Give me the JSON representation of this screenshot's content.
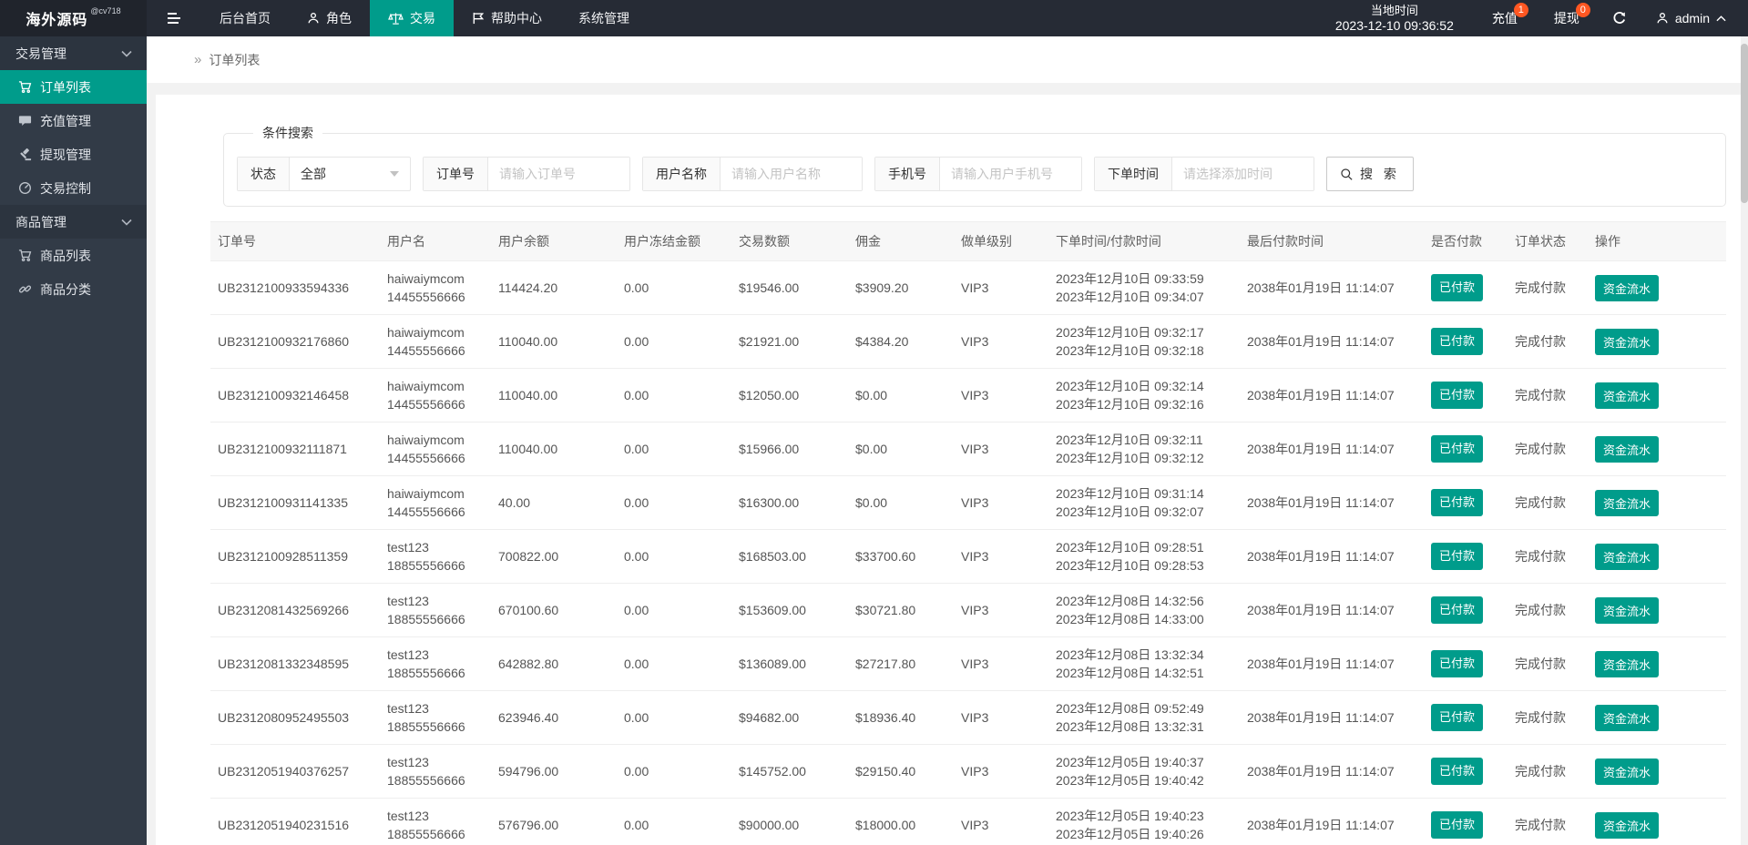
{
  "colors": {
    "accent": "#009C8B",
    "badge": "#FF5722"
  },
  "header": {
    "logo": "海外源码",
    "logo_badge": "@cv718",
    "menu": [
      {
        "label": "后台首页"
      },
      {
        "label": "角色"
      },
      {
        "label": "交易"
      },
      {
        "label": "帮助中心"
      },
      {
        "label": "系统管理"
      }
    ],
    "local_time_label": "当地时间",
    "local_time_value": "2023-12-10 09:36:52",
    "recharge_label": "充值",
    "recharge_badge": "1",
    "withdraw_label": "提现",
    "withdraw_badge": "0",
    "username": "admin"
  },
  "sidebar": {
    "items": [
      {
        "label": "交易管理"
      },
      {
        "label": "订单列表"
      },
      {
        "label": "充值管理"
      },
      {
        "label": "提现管理"
      },
      {
        "label": "交易控制"
      },
      {
        "label": "商品管理"
      },
      {
        "label": "商品列表"
      },
      {
        "label": "商品分类"
      }
    ]
  },
  "breadcrumb": {
    "separator": "»",
    "label": "订单列表"
  },
  "search": {
    "legend": "条件搜索",
    "status_label": "状态",
    "status_value": "全部",
    "order_label": "订单号",
    "order_placeholder": "请输入订单号",
    "username_label": "用户名称",
    "username_placeholder": "请输入用户名称",
    "phone_label": "手机号",
    "phone_placeholder": "请输入用户手机号",
    "time_label": "下单时间",
    "time_placeholder": "请选择添加时间",
    "search_button": "搜 索"
  },
  "table": {
    "headers": [
      "订单号",
      "用户名",
      "用户余额",
      "用户冻结金额",
      "交易数额",
      "佣金",
      "做单级别",
      "下单时间/付款时间",
      "最后付款时间",
      "是否付款",
      "订单状态",
      "操作"
    ],
    "rows": [
      {
        "order_no": "UB2312100933594336",
        "username": "haiwaiymcom",
        "phone": "14455556666",
        "balance": "114424.20",
        "frozen": "0.00",
        "amount": "$19546.00",
        "commission": "$3909.20",
        "level": "VIP3",
        "order_time": "2023年12月10日 09:33:59",
        "pay_time": "2023年12月10日 09:34:07",
        "last_pay_time": "2038年01月19日 11:14:07",
        "pay_status": "已付款",
        "order_status": "完成付款",
        "action": "资金流水"
      },
      {
        "order_no": "UB2312100932176860",
        "username": "haiwaiymcom",
        "phone": "14455556666",
        "balance": "110040.00",
        "frozen": "0.00",
        "amount": "$21921.00",
        "commission": "$4384.20",
        "level": "VIP3",
        "order_time": "2023年12月10日 09:32:17",
        "pay_time": "2023年12月10日 09:32:18",
        "last_pay_time": "2038年01月19日 11:14:07",
        "pay_status": "已付款",
        "order_status": "完成付款",
        "action": "资金流水"
      },
      {
        "order_no": "UB2312100932146458",
        "username": "haiwaiymcom",
        "phone": "14455556666",
        "balance": "110040.00",
        "frozen": "0.00",
        "amount": "$12050.00",
        "commission": "$0.00",
        "level": "VIP3",
        "order_time": "2023年12月10日 09:32:14",
        "pay_time": "2023年12月10日 09:32:16",
        "last_pay_time": "2038年01月19日 11:14:07",
        "pay_status": "已付款",
        "order_status": "完成付款",
        "action": "资金流水"
      },
      {
        "order_no": "UB2312100932111871",
        "username": "haiwaiymcom",
        "phone": "14455556666",
        "balance": "110040.00",
        "frozen": "0.00",
        "amount": "$15966.00",
        "commission": "$0.00",
        "level": "VIP3",
        "order_time": "2023年12月10日 09:32:11",
        "pay_time": "2023年12月10日 09:32:12",
        "last_pay_time": "2038年01月19日 11:14:07",
        "pay_status": "已付款",
        "order_status": "完成付款",
        "action": "资金流水"
      },
      {
        "order_no": "UB2312100931141335",
        "username": "haiwaiymcom",
        "phone": "14455556666",
        "balance": "40.00",
        "frozen": "0.00",
        "amount": "$16300.00",
        "commission": "$0.00",
        "level": "VIP3",
        "order_time": "2023年12月10日 09:31:14",
        "pay_time": "2023年12月10日 09:32:07",
        "last_pay_time": "2038年01月19日 11:14:07",
        "pay_status": "已付款",
        "order_status": "完成付款",
        "action": "资金流水"
      },
      {
        "order_no": "UB2312100928511359",
        "username": "test123",
        "phone": "18855556666",
        "balance": "700822.00",
        "frozen": "0.00",
        "amount": "$168503.00",
        "commission": "$33700.60",
        "level": "VIP3",
        "order_time": "2023年12月10日 09:28:51",
        "pay_time": "2023年12月10日 09:28:53",
        "last_pay_time": "2038年01月19日 11:14:07",
        "pay_status": "已付款",
        "order_status": "完成付款",
        "action": "资金流水"
      },
      {
        "order_no": "UB2312081432569266",
        "username": "test123",
        "phone": "18855556666",
        "balance": "670100.60",
        "frozen": "0.00",
        "amount": "$153609.00",
        "commission": "$30721.80",
        "level": "VIP3",
        "order_time": "2023年12月08日 14:32:56",
        "pay_time": "2023年12月08日 14:33:00",
        "last_pay_time": "2038年01月19日 11:14:07",
        "pay_status": "已付款",
        "order_status": "完成付款",
        "action": "资金流水"
      },
      {
        "order_no": "UB2312081332348595",
        "username": "test123",
        "phone": "18855556666",
        "balance": "642882.80",
        "frozen": "0.00",
        "amount": "$136089.00",
        "commission": "$27217.80",
        "level": "VIP3",
        "order_time": "2023年12月08日 13:32:34",
        "pay_time": "2023年12月08日 14:32:51",
        "last_pay_time": "2038年01月19日 11:14:07",
        "pay_status": "已付款",
        "order_status": "完成付款",
        "action": "资金流水"
      },
      {
        "order_no": "UB2312080952495503",
        "username": "test123",
        "phone": "18855556666",
        "balance": "623946.40",
        "frozen": "0.00",
        "amount": "$94682.00",
        "commission": "$18936.40",
        "level": "VIP3",
        "order_time": "2023年12月08日 09:52:49",
        "pay_time": "2023年12月08日 13:32:31",
        "last_pay_time": "2038年01月19日 11:14:07",
        "pay_status": "已付款",
        "order_status": "完成付款",
        "action": "资金流水"
      },
      {
        "order_no": "UB2312051940376257",
        "username": "test123",
        "phone": "18855556666",
        "balance": "594796.00",
        "frozen": "0.00",
        "amount": "$145752.00",
        "commission": "$29150.40",
        "level": "VIP3",
        "order_time": "2023年12月05日 19:40:37",
        "pay_time": "2023年12月05日 19:40:42",
        "last_pay_time": "2038年01月19日 11:14:07",
        "pay_status": "已付款",
        "order_status": "完成付款",
        "action": "资金流水"
      },
      {
        "order_no": "UB2312051940231516",
        "username": "test123",
        "phone": "18855556666",
        "balance": "576796.00",
        "frozen": "0.00",
        "amount": "$90000.00",
        "commission": "$18000.00",
        "level": "VIP3",
        "order_time": "2023年12月05日 19:40:23",
        "pay_time": "2023年12月05日 19:40:26",
        "last_pay_time": "2038年01月19日 11:14:07",
        "pay_status": "已付款",
        "order_status": "完成付款",
        "action": "资金流水"
      }
    ]
  }
}
